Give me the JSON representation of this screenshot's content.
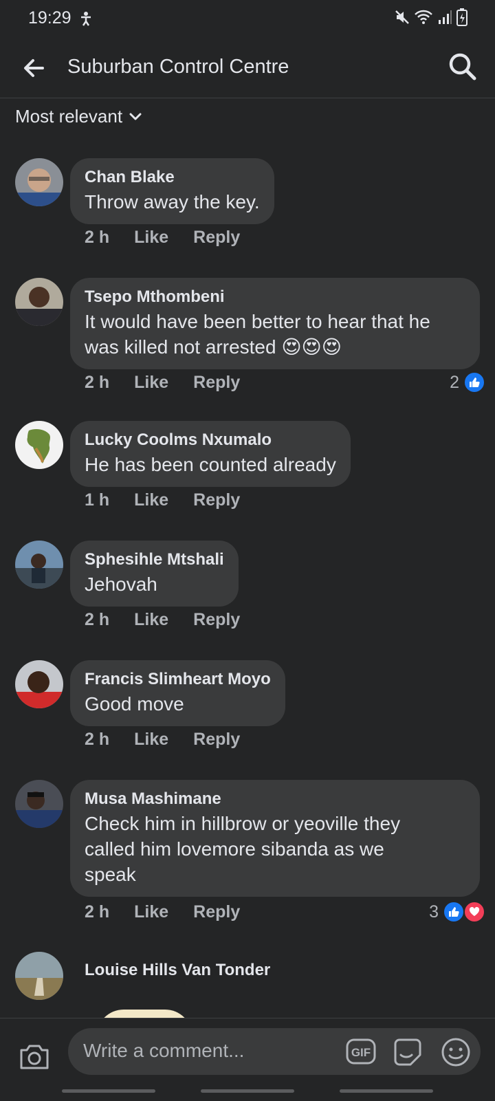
{
  "status": {
    "time": "19:29"
  },
  "header": {
    "title": "Suburban Control Centre"
  },
  "sort": {
    "label": "Most relevant"
  },
  "comments": [
    {
      "author": "Chan Blake",
      "text": "Throw away the key.",
      "time": "2 h",
      "like": "Like",
      "reply": "Reply"
    },
    {
      "author": "Tsepo Mthombeni",
      "text_line1": "It would have been better to hear that he",
      "text_line2": "was killed not arrested 😍😍😍",
      "time": "2 h",
      "like": "Like",
      "reply": "Reply",
      "reactions": "2"
    },
    {
      "author": "Lucky Coolms Nxumalo",
      "text": "He has been counted already",
      "time": "1 h",
      "like": "Like",
      "reply": "Reply"
    },
    {
      "author": "Sphesihle Mtshali",
      "text": "Jehovah",
      "time": "2 h",
      "like": "Like",
      "reply": "Reply"
    },
    {
      "author": "Francis Slimheart Moyo",
      "text": "Good move",
      "time": "2 h",
      "like": "Like",
      "reply": "Reply"
    },
    {
      "author": "Musa Mashimane",
      "text_line1": "Check him in hillbrow or yeoville they",
      "text_line2": "called him lovemore sibanda as we",
      "text_line3": "speak",
      "time": "2 h",
      "like": "Like",
      "reply": "Reply",
      "reactions": "3"
    },
    {
      "author": "Louise Hills Van Tonder"
    }
  ],
  "composer": {
    "placeholder": "Write a comment..."
  },
  "colors": {
    "background": "#242526",
    "bubble": "#3a3b3c",
    "like_blue": "#1877f2",
    "love_red": "#f33e58"
  }
}
